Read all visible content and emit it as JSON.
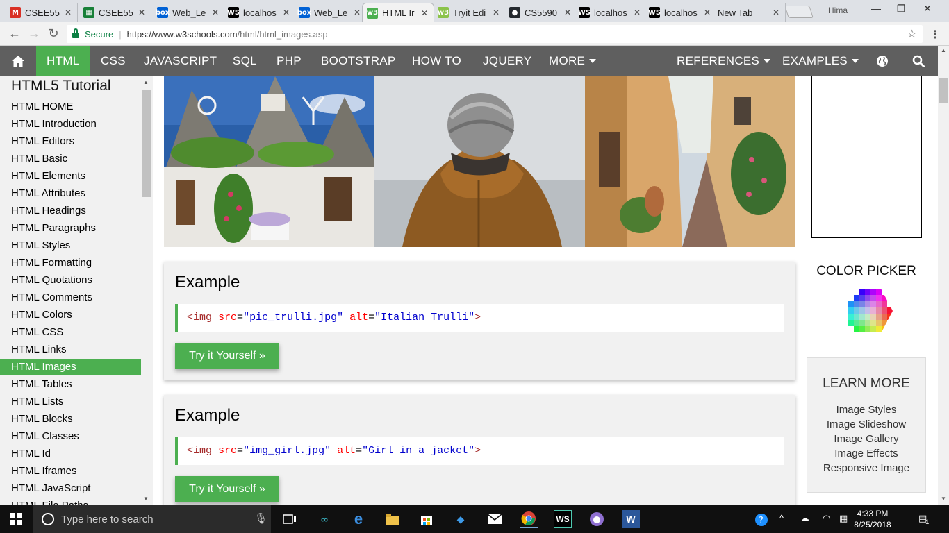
{
  "browser": {
    "tabs": [
      {
        "label": "CSEE55",
        "icon": "gmail-icon",
        "fav_text": "M",
        "fav_color": "#d93025"
      },
      {
        "label": "CSEE55",
        "icon": "sheets-icon",
        "fav_text": "▦",
        "fav_color": "#188038"
      },
      {
        "label": "Web_Le",
        "icon": "box-icon",
        "fav_text": "box",
        "fav_color": "#0061d5"
      },
      {
        "label": "localhos",
        "icon": "webstorm-icon",
        "fav_text": "WS",
        "fav_color": "#000000"
      },
      {
        "label": "Web_Le",
        "icon": "box-icon",
        "fav_text": "box",
        "fav_color": "#0061d5"
      },
      {
        "label": "HTML Ir",
        "icon": "w3schools-icon",
        "fav_text": "w3",
        "fav_color": "#4caf50",
        "active": true
      },
      {
        "label": "Tryit Edi",
        "icon": "w3schools-icon",
        "fav_text": "w3",
        "fav_color": "#8bc34a"
      },
      {
        "label": "CS5590",
        "icon": "github-icon",
        "fav_text": "●",
        "fav_color": "#24292e"
      },
      {
        "label": "localhos",
        "icon": "webstorm-icon",
        "fav_text": "WS",
        "fav_color": "#000000"
      },
      {
        "label": "localhos",
        "icon": "webstorm-icon",
        "fav_text": "WS",
        "fav_color": "#000000"
      },
      {
        "label": "New Tab",
        "icon": "",
        "fav_text": "",
        "fav_color": ""
      }
    ],
    "user": "Hima",
    "secure_label": "Secure",
    "url_base": "https://www.w3schools.com",
    "url_path": "/html/html_images.asp"
  },
  "topnav": {
    "items": [
      "HTML",
      "CSS",
      "JAVASCRIPT",
      "SQL",
      "PHP",
      "BOOTSTRAP",
      "HOW TO",
      "JQUERY",
      "MORE"
    ],
    "right": [
      "REFERENCES",
      "EXAMPLES"
    ]
  },
  "sidebar": {
    "title": "HTML5 Tutorial",
    "items": [
      "HTML HOME",
      "HTML Introduction",
      "HTML Editors",
      "HTML Basic",
      "HTML Elements",
      "HTML Attributes",
      "HTML Headings",
      "HTML Paragraphs",
      "HTML Styles",
      "HTML Formatting",
      "HTML Quotations",
      "HTML Comments",
      "HTML Colors",
      "HTML CSS",
      "HTML Links",
      "HTML Images",
      "HTML Tables",
      "HTML Lists",
      "HTML Blocks",
      "HTML Classes",
      "HTML Id",
      "HTML Iframes",
      "HTML JavaScript",
      "HTML File Paths"
    ],
    "active_index": 15
  },
  "examples": [
    {
      "title": "Example",
      "tag_open": "<img",
      "attr1": "src",
      "val1": "\"pic_trulli.jpg\"",
      "attr2": "alt",
      "val2": "\"Italian Trulli\"",
      "tag_close": ">",
      "button": "Try it Yourself »"
    },
    {
      "title": "Example",
      "tag_open": "<img",
      "attr1": "src",
      "val1": "\"img_girl.jpg\"",
      "attr2": "alt",
      "val2": "\"Girl in a jacket\"",
      "tag_close": ">",
      "button": "Try it Yourself »"
    }
  ],
  "right": {
    "color_picker": "COLOR PICKER",
    "learn_more": "LEARN MORE",
    "links": [
      "Image Styles",
      "Image Slideshow",
      "Image Gallery",
      "Image Effects",
      "Responsive Image"
    ]
  },
  "taskbar": {
    "search_placeholder": "Type here to search",
    "time": "4:33 PM",
    "date": "8/25/2018",
    "notification_count": "1"
  },
  "colors": {
    "accent": "#4caf50",
    "nav": "#5f5f5f",
    "taskbar": "#101010"
  }
}
